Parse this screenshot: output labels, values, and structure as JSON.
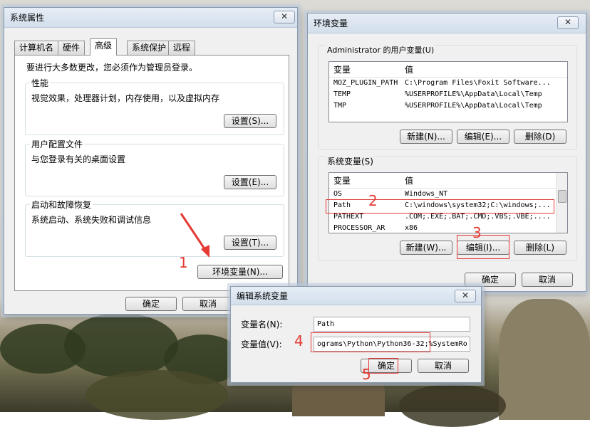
{
  "sys_props": {
    "title": "系统属性",
    "close": "✕",
    "tabs": [
      "计算机名",
      "硬件",
      "高级",
      "系统保护",
      "远程"
    ],
    "admin_notice": "要进行大多数更改，您必须作为管理员登录。",
    "performance": {
      "label": "性能",
      "desc": "视觉效果，处理器计划，内存使用，以及虚拟内存",
      "button": "设置(S)..."
    },
    "user_profiles": {
      "label": "用户配置文件",
      "desc": "与您登录有关的桌面设置",
      "button": "设置(E)..."
    },
    "startup": {
      "label": "启动和故障恢复",
      "desc": "系统启动、系统失败和调试信息",
      "button": "设置(T)..."
    },
    "env_button": "环境变量(N)...",
    "ok": "确定",
    "cancel": "取消"
  },
  "env_vars": {
    "title": "环境变量",
    "close": "✕",
    "user_section": "Administrator 的用户变量(U)",
    "col_var": "变量",
    "col_val": "值",
    "user_rows": [
      {
        "name": "MOZ_PLUGIN_PATH",
        "value": "C:\\Program Files\\Foxit Software..."
      },
      {
        "name": "TEMP",
        "value": "%USERPROFILE%\\AppData\\Local\\Temp"
      },
      {
        "name": "TMP",
        "value": "%USERPROFILE%\\AppData\\Local\\Temp"
      }
    ],
    "user_new": "新建(N)...",
    "user_edit": "编辑(E)...",
    "user_delete": "删除(D)",
    "sys_section": "系统变量(S)",
    "sys_rows": [
      {
        "name": "OS",
        "value": "Windows_NT"
      },
      {
        "name": "Path",
        "value": "C:\\windows\\system32;C:\\windows;..."
      },
      {
        "name": "PATHEXT",
        "value": ".COM;.EXE;.BAT;.CMD;.VBS;.VBE;...."
      },
      {
        "name": "PROCESSOR_AR",
        "value": "x86"
      }
    ],
    "sys_new": "新建(W)...",
    "sys_edit": "编辑(I)...",
    "sys_delete": "删除(L)",
    "ok": "确定",
    "cancel": "取消"
  },
  "edit_dialog": {
    "title": "编辑系统变量",
    "close": "✕",
    "name_label": "变量名(N):",
    "name_value": "Path",
    "value_label": "变量值(V):",
    "value_value": "ograms\\Python\\Python36-32;%SystemRo",
    "ok": "确定",
    "cancel": "取消"
  },
  "annotations": [
    "1",
    "2",
    "3",
    "4",
    "5"
  ],
  "colors": {
    "annotation": "#e53935",
    "window_bg": "#f0f0f0",
    "selected": "#ffffff"
  }
}
